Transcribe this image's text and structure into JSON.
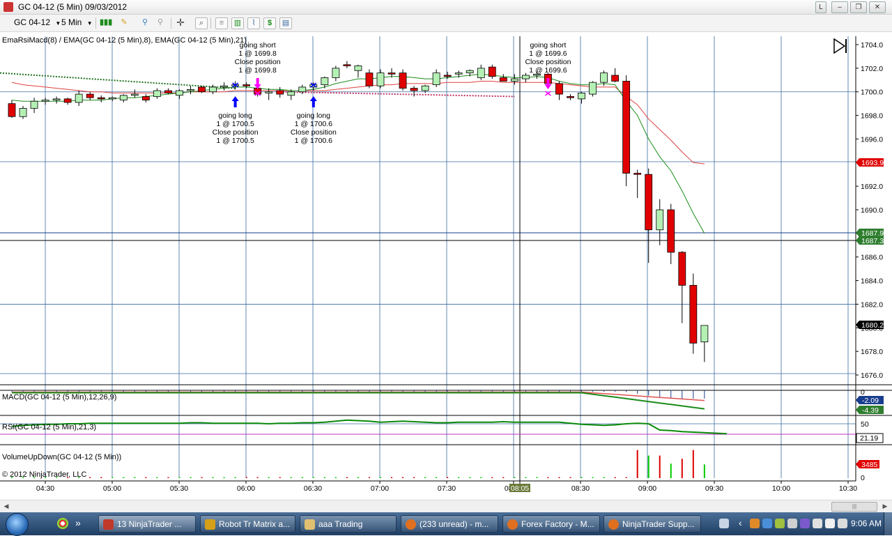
{
  "window": {
    "title": "GC 04-12 (5 Min)  09/03/2012",
    "buttons": [
      "L",
      "–",
      "❐",
      "✕"
    ]
  },
  "toolbar": {
    "instrument": "GC 04-12",
    "interval": "5 Min",
    "icons": [
      "bar-type-icon",
      "drawing-pencil-icon",
      "pin-icon",
      "magnet-icon",
      "crosshair-icon",
      "zoom-icon",
      "strategy-icon",
      "indicator-icon",
      "chart-properties-icon",
      "dollar-icon",
      "data-box-icon"
    ]
  },
  "colors": {
    "up_candle": "#b4f0b4",
    "down_candle": "#e00000",
    "ema_red": "#e04040",
    "ema_green": "#1a8c1a",
    "grid": "#3a6aa0",
    "last_price_label": "#e00000",
    "rsi_line": "#0a8a0a",
    "macd_signal": "#e05050",
    "macd_label": "#1a3e8e"
  },
  "chart_data": {
    "type": "candlestick",
    "price_panel": {
      "title": "EmaRsiMacd(8) / EMA(GC 04-12 (5 Min),8), EMA(GC 04-12 (5 Min),21)",
      "ylim": [
        1675,
        1705
      ],
      "y_ticks": [
        "1704.0",
        "1702.0",
        "1700.0",
        "1698.0",
        "1696.0",
        "1694.0",
        "1692.0",
        "1690.0",
        "1688.0",
        "1686.0",
        "1684.0",
        "1682.0",
        "1680.0",
        "1678.0",
        "1676.0"
      ],
      "price_markers": [
        {
          "value": "1693.9",
          "price": 1693.9,
          "color": "#e00000"
        },
        {
          "value": "1687.9",
          "price": 1687.9,
          "color": "#2e7d2e"
        },
        {
          "value": "1687.3",
          "price": 1687.3,
          "color": "#2e7d2e"
        },
        {
          "value": "1680.2",
          "price": 1680.2,
          "color": "#000000"
        }
      ],
      "horizontal_lines": [
        1700.0,
        1687.95,
        1687.3
      ],
      "candles": [
        {
          "o": 1699.0,
          "h": 1699.3,
          "l": 1697.8,
          "c": 1697.9
        },
        {
          "o": 1697.9,
          "h": 1698.8,
          "l": 1697.7,
          "c": 1698.6
        },
        {
          "o": 1698.6,
          "h": 1699.5,
          "l": 1698.2,
          "c": 1699.2
        },
        {
          "o": 1699.2,
          "h": 1699.5,
          "l": 1698.9,
          "c": 1699.3
        },
        {
          "o": 1699.3,
          "h": 1699.6,
          "l": 1699.0,
          "c": 1699.4
        },
        {
          "o": 1699.4,
          "h": 1699.5,
          "l": 1698.9,
          "c": 1699.1
        },
        {
          "o": 1699.1,
          "h": 1700.1,
          "l": 1698.8,
          "c": 1699.8
        },
        {
          "o": 1699.8,
          "h": 1700.0,
          "l": 1699.3,
          "c": 1699.5
        },
        {
          "o": 1699.5,
          "h": 1699.7,
          "l": 1699.1,
          "c": 1699.4
        },
        {
          "o": 1699.4,
          "h": 1699.6,
          "l": 1699.2,
          "c": 1699.5
        },
        {
          "o": 1699.3,
          "h": 1699.8,
          "l": 1699.1,
          "c": 1699.7
        },
        {
          "o": 1699.7,
          "h": 1700.2,
          "l": 1699.5,
          "c": 1699.8
        },
        {
          "o": 1699.6,
          "h": 1699.8,
          "l": 1699.1,
          "c": 1699.3
        },
        {
          "o": 1699.6,
          "h": 1700.3,
          "l": 1699.4,
          "c": 1700.1
        },
        {
          "o": 1700.1,
          "h": 1700.3,
          "l": 1699.8,
          "c": 1699.9
        },
        {
          "o": 1699.7,
          "h": 1700.2,
          "l": 1699.4,
          "c": 1700.1
        },
        {
          "o": 1700.1,
          "h": 1700.5,
          "l": 1699.8,
          "c": 1700.2
        },
        {
          "o": 1700.4,
          "h": 1700.5,
          "l": 1699.9,
          "c": 1700.0
        },
        {
          "o": 1700.0,
          "h": 1700.6,
          "l": 1699.8,
          "c": 1700.4
        },
        {
          "o": 1700.4,
          "h": 1700.8,
          "l": 1700.1,
          "c": 1700.5
        },
        {
          "o": 1700.5,
          "h": 1700.9,
          "l": 1700.2,
          "c": 1700.6
        },
        {
          "o": 1700.6,
          "h": 1700.8,
          "l": 1700.3,
          "c": 1700.5
        },
        {
          "o": 1700.3,
          "h": 1700.7,
          "l": 1699.6,
          "c": 1699.8
        },
        {
          "o": 1699.9,
          "h": 1700.3,
          "l": 1699.3,
          "c": 1700.0
        },
        {
          "o": 1700.1,
          "h": 1700.4,
          "l": 1699.5,
          "c": 1699.8
        },
        {
          "o": 1699.7,
          "h": 1700.2,
          "l": 1699.3,
          "c": 1700.0
        },
        {
          "o": 1700.0,
          "h": 1700.6,
          "l": 1699.8,
          "c": 1700.4
        },
        {
          "o": 1700.4,
          "h": 1700.8,
          "l": 1700.1,
          "c": 1700.6
        },
        {
          "o": 1700.6,
          "h": 1701.3,
          "l": 1700.3,
          "c": 1701.2
        },
        {
          "o": 1701.2,
          "h": 1702.2,
          "l": 1700.9,
          "c": 1702.0
        },
        {
          "o": 1702.3,
          "h": 1702.6,
          "l": 1702.0,
          "c": 1702.2
        },
        {
          "o": 1701.8,
          "h": 1702.3,
          "l": 1701.2,
          "c": 1702.2
        },
        {
          "o": 1701.6,
          "h": 1701.9,
          "l": 1700.3,
          "c": 1700.5
        },
        {
          "o": 1700.5,
          "h": 1701.9,
          "l": 1700.3,
          "c": 1701.6
        },
        {
          "o": 1701.6,
          "h": 1702.0,
          "l": 1701.2,
          "c": 1701.5
        },
        {
          "o": 1701.6,
          "h": 1701.9,
          "l": 1700.1,
          "c": 1700.3
        },
        {
          "o": 1700.3,
          "h": 1700.5,
          "l": 1699.6,
          "c": 1700.1
        },
        {
          "o": 1700.1,
          "h": 1700.6,
          "l": 1699.9,
          "c": 1700.5
        },
        {
          "o": 1700.6,
          "h": 1701.9,
          "l": 1700.4,
          "c": 1701.6
        },
        {
          "o": 1701.4,
          "h": 1701.7,
          "l": 1701.1,
          "c": 1701.3
        },
        {
          "o": 1701.5,
          "h": 1701.8,
          "l": 1701.2,
          "c": 1701.6
        },
        {
          "o": 1701.6,
          "h": 1701.9,
          "l": 1701.3,
          "c": 1701.8
        },
        {
          "o": 1701.2,
          "h": 1702.3,
          "l": 1701.0,
          "c": 1702.0
        },
        {
          "o": 1702.1,
          "h": 1702.3,
          "l": 1701.1,
          "c": 1701.3
        },
        {
          "o": 1701.2,
          "h": 1701.5,
          "l": 1700.9,
          "c": 1700.9
        },
        {
          "o": 1700.9,
          "h": 1701.5,
          "l": 1700.6,
          "c": 1701.1
        },
        {
          "o": 1701.1,
          "h": 1701.6,
          "l": 1700.8,
          "c": 1701.4
        },
        {
          "o": 1701.4,
          "h": 1701.7,
          "l": 1701.1,
          "c": 1701.5
        },
        {
          "o": 1701.5,
          "h": 1701.6,
          "l": 1700.5,
          "c": 1700.7
        },
        {
          "o": 1700.7,
          "h": 1700.9,
          "l": 1699.3,
          "c": 1699.8
        },
        {
          "o": 1699.6,
          "h": 1699.8,
          "l": 1699.3,
          "c": 1699.5
        },
        {
          "o": 1699.4,
          "h": 1700.0,
          "l": 1699.0,
          "c": 1699.9
        },
        {
          "o": 1699.8,
          "h": 1700.9,
          "l": 1699.6,
          "c": 1700.8
        },
        {
          "o": 1700.8,
          "h": 1701.8,
          "l": 1700.5,
          "c": 1701.6
        },
        {
          "o": 1701.4,
          "h": 1702.0,
          "l": 1700.8,
          "c": 1700.9
        },
        {
          "o": 1700.9,
          "h": 1701.4,
          "l": 1692.0,
          "c": 1693.1
        },
        {
          "o": 1693.1,
          "h": 1693.4,
          "l": 1691.0,
          "c": 1693.0
        },
        {
          "o": 1693.0,
          "h": 1693.5,
          "l": 1685.5,
          "c": 1688.3
        },
        {
          "o": 1688.3,
          "h": 1690.9,
          "l": 1687.0,
          "c": 1690.0
        },
        {
          "o": 1690.0,
          "h": 1690.5,
          "l": 1685.4,
          "c": 1686.4
        },
        {
          "o": 1686.4,
          "h": 1686.5,
          "l": 1680.4,
          "c": 1683.6
        },
        {
          "o": 1683.6,
          "h": 1684.6,
          "l": 1677.8,
          "c": 1678.7
        },
        {
          "o": 1678.8,
          "h": 1680.2,
          "l": 1677.1,
          "c": 1680.2
        }
      ],
      "ema8": [
        1699.3,
        1699.2,
        1699.2,
        1699.2,
        1699.2,
        1699.2,
        1699.3,
        1699.3,
        1699.3,
        1699.4,
        1699.5,
        1699.5,
        1699.6,
        1699.7,
        1699.8,
        1699.9,
        1700.0,
        1700.1,
        1700.2,
        1700.3,
        1700.4,
        1700.4,
        1700.3,
        1700.2,
        1700.2,
        1700.1,
        1700.1,
        1700.2,
        1700.4,
        1700.7,
        1700.9,
        1701.1,
        1701.1,
        1701.2,
        1701.3,
        1701.3,
        1701.2,
        1701.1,
        1701.1,
        1701.2,
        1701.3,
        1701.4,
        1701.5,
        1701.4,
        1701.3,
        1701.2,
        1701.2,
        1701.3,
        1701.2,
        1700.9,
        1700.7,
        1700.6,
        1700.6,
        1700.7,
        1700.6,
        1699.2,
        1698.0,
        1696.0,
        1694.5,
        1693.3,
        1691.6,
        1689.7,
        1688.0
      ],
      "ema21": [
        1700.8,
        1700.6,
        1700.5,
        1700.4,
        1700.3,
        1700.2,
        1700.1,
        1700.0,
        1700.0,
        1699.9,
        1699.9,
        1699.9,
        1699.9,
        1699.9,
        1699.9,
        1699.9,
        1700.0,
        1700.0,
        1700.0,
        1700.0,
        1700.1,
        1700.1,
        1700.1,
        1700.1,
        1700.1,
        1700.1,
        1700.1,
        1700.1,
        1700.1,
        1700.2,
        1700.3,
        1700.4,
        1700.5,
        1700.6,
        1700.6,
        1700.7,
        1700.7,
        1700.7,
        1700.7,
        1700.8,
        1700.8,
        1700.8,
        1700.9,
        1700.9,
        1700.8,
        1700.8,
        1700.8,
        1700.8,
        1700.8,
        1700.7,
        1700.6,
        1700.5,
        1700.4,
        1700.4,
        1700.4,
        1699.6,
        1698.9,
        1697.7,
        1696.8,
        1695.9,
        1694.9,
        1694.0,
        1693.9
      ],
      "dotted_green": {
        "from": 1701.6,
        "to": 1700.3,
        "end_index": 20
      },
      "dotted_red": {
        "from_index": 24,
        "from": 1700.0,
        "to": 1699.6,
        "end_index": 45
      },
      "signals": [
        {
          "index": 20,
          "dir": "up",
          "color": "#0000ff",
          "lines": [
            "going long",
            "1 @ 1700.5",
            "Close position",
            "1 @ 1700.5"
          ]
        },
        {
          "index": 22,
          "dir": "down",
          "color": "#ff00ff",
          "lines": [
            "going short",
            "1 @ 1699.8",
            "Close position",
            "1 @ 1699.8"
          ]
        },
        {
          "index": 27,
          "dir": "up",
          "color": "#0000ff",
          "lines": [
            "going long",
            "1 @ 1700.6",
            "Close position",
            "1 @ 1700.6"
          ]
        },
        {
          "index": 48,
          "dir": "down",
          "color": "#ff00ff",
          "lines": [
            "going short",
            "1 @ 1699.6",
            "Close position",
            "1 @ 1699.6"
          ]
        }
      ]
    },
    "macd_panel": {
      "title": "MACD(GC 04-12 (5 Min),12,26,9)",
      "markers": [
        {
          "value": "-2.09",
          "color": "#1a3e8e"
        },
        {
          "value": "-4.39",
          "color": "#2e7d2e"
        }
      ],
      "zero_label": "0"
    },
    "rsi_panel": {
      "title": "RSI(GC 04-12 (5 Min),21,3)",
      "ticks": [
        "50"
      ],
      "marker": "21.19",
      "values": [
        45,
        47,
        48,
        49,
        49,
        50,
        50,
        51,
        51,
        51,
        51,
        51,
        51,
        51,
        51,
        51,
        52,
        52,
        51,
        51,
        51,
        51,
        51,
        50,
        51,
        51,
        52,
        52,
        53,
        55,
        57,
        56,
        55,
        53,
        54,
        55,
        54,
        53,
        52,
        52,
        53,
        53,
        53,
        53,
        54,
        53,
        53,
        53,
        53,
        53,
        51,
        49,
        48,
        47,
        48,
        50,
        51,
        50,
        38,
        37,
        35,
        34,
        33,
        32,
        31
      ]
    },
    "volume_panel": {
      "title": "VolumeUpDown(GC 04-12 (5 Min))",
      "ticks": [
        "0"
      ],
      "marker": "3485",
      "volumes": [
        10,
        10,
        10,
        10,
        8,
        8,
        10,
        8,
        8,
        8,
        10,
        10,
        8,
        8,
        10,
        10,
        10,
        10,
        10,
        12,
        14,
        10,
        12,
        10,
        8,
        10,
        12,
        14,
        16,
        22,
        14,
        12,
        18,
        14,
        12,
        16,
        10,
        12,
        14,
        10,
        10,
        12,
        14,
        14,
        12,
        10,
        10,
        10,
        14,
        16,
        12,
        10,
        10,
        12,
        14,
        16,
        3485,
        2800,
        2800,
        1800,
        2400,
        3485,
        1700
      ],
      "volume_up": [
        true,
        true,
        true,
        true,
        true,
        false,
        true,
        false,
        false,
        true,
        true,
        true,
        false,
        true,
        false,
        true,
        true,
        false,
        true,
        true,
        true,
        false,
        false,
        true,
        false,
        true,
        true,
        true,
        true,
        true,
        false,
        true,
        false,
        true,
        false,
        false,
        false,
        true,
        true,
        false,
        true,
        true,
        true,
        false,
        false,
        true,
        true,
        true,
        false,
        false,
        false,
        true,
        true,
        true,
        false,
        false,
        false,
        true,
        false,
        true,
        false,
        false,
        true
      ],
      "vmax": 3800
    },
    "x_ticks": [
      "04:30",
      "05:00",
      "05:30",
      "06:00",
      "06:30",
      "07:00",
      "07:30",
      "08:00",
      "08:30",
      "09:00",
      "09:30",
      "10:00",
      "10:30"
    ],
    "cursor_time": "08:05",
    "copyright": "© 2012 NinjaTrader, LLC"
  },
  "scrollbar": {
    "left": "◀",
    "right": "▶",
    "grip": "|||"
  },
  "taskbar": {
    "buttons": [
      {
        "label": "13 NinjaTrader ...",
        "color": "#c0392b"
      },
      {
        "label": "Robot Tr Matrix a...",
        "color": "#d4a017"
      },
      {
        "label": "aaa Trading",
        "color": "#e0c070"
      },
      {
        "label": "(233 unread) - m...",
        "color": "#e07020"
      },
      {
        "label": "Forex Factory - M...",
        "color": "#e07020"
      },
      {
        "label": "NinjaTrader Supp...",
        "color": "#e07020"
      }
    ],
    "overflow": "»",
    "tray_arrow": "‹",
    "clock": "9:06 AM"
  }
}
